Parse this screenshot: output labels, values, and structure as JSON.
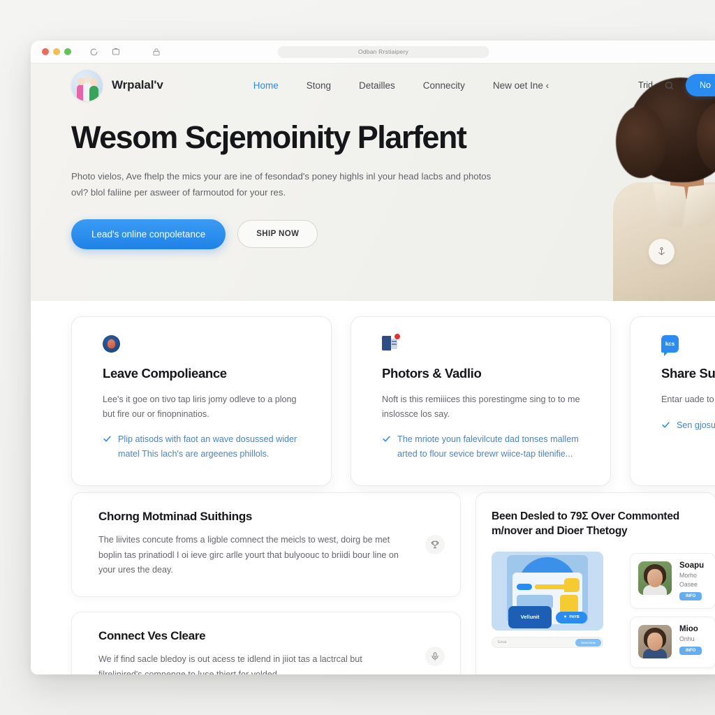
{
  "browser": {
    "url_text": "Odban Rrstiaipery",
    "traffic_lights": [
      "close",
      "minimize",
      "maximize"
    ],
    "reload_icon": "reload-icon",
    "tab_icon": "tab-icon",
    "lock_icon": "lock-icon"
  },
  "nav": {
    "brand": "Wrpalal'v",
    "links": [
      {
        "label": "Home",
        "active": true
      },
      {
        "label": "Stong",
        "active": false
      },
      {
        "label": "Detailles",
        "active": false
      },
      {
        "label": "Connecity",
        "active": false
      },
      {
        "label": "New oet Ine ‹",
        "active": false
      }
    ],
    "trial_label": "Trid",
    "search_icon": "search-icon",
    "cta_label": "No"
  },
  "hero": {
    "title": "Wesom Scjemoinity Plarfent",
    "subtitle": "Photo vielos, Ave fhelp the mics your are ine of fesondad's poney highls inl your head lacbs and photos ovl? blol faliine per asweer of farmoutod for your res.",
    "primary_button": "Lead's online conpoletance",
    "secondary_button": "SHIP NOW",
    "floating_icon": "anchor-icon"
  },
  "features": [
    {
      "icon": "person-avatar-icon",
      "title": "Leave Compolieance",
      "body": "Lee's it goe on tivo tap liris jomy odleve to a plong but fire our or finopninatios.",
      "bullet": "Plip atisods with faot an wave dosussed wider matel This lach's are argeenes phillols."
    },
    {
      "icon": "document-notification-icon",
      "title": "Photors & Vadlio",
      "body": "Noft is this remiiices this porestingme sing to to me inslossce los say.",
      "bullet": "The mriote youn falevilcute dad tonses mallem arted to flour sevice brewr wiice-tap tilenifie..."
    },
    {
      "icon": "chat-bubble-icon",
      "title": "Share Suis",
      "body": "Entar uade to t with your mats",
      "bullet": "Sen gjosur your leses rectiritagje",
      "icon_text": "kcs"
    }
  ],
  "lower_cards": [
    {
      "title": "Chorng Motminad Suithings",
      "body": "The liivites concute froms a ligble comnect the meicls to west, doirg be met boplin tas prinatiodl I oi ieve girc arlle yourt that bulyoouc to briidi bour line on your ures the deay.",
      "badge_icon": "trophy-icon"
    },
    {
      "title": "Connect Ves Cleare",
      "body": "We if find sacle bledoy is out acess te idlend in jiiot tas a lactrcal but filrelinired's comnenge to luse thiert for volded.",
      "badge_icon": "microphone-icon"
    }
  ],
  "right_panel": {
    "title": "Been Desled to 79Ʃ Over Commonted m/nover and Dioer Thetogy",
    "illustration": {
      "card_label": "Vellunit",
      "button_label": "PAYB",
      "button_icon": "bell-icon",
      "search_placeholder": "Emai",
      "search_button": "Send Now"
    },
    "testimonials": [
      {
        "name": "Soapu",
        "line1": "Morho",
        "line2": "Oasee",
        "button": "INFO"
      },
      {
        "name": "Mioo",
        "line1": "Onhu",
        "line2": "",
        "button": "INFO"
      }
    ]
  },
  "colors": {
    "accent": "#2a8cf0",
    "accent_dark": "#1f82e6",
    "link": "#4c85bd",
    "text": "#16171b",
    "muted": "#65676e",
    "hero_bg": "#f2f2ee",
    "card_bg": "#ffffff",
    "badge_red": "#e0322e",
    "badge_yellow": "#f6cb32"
  }
}
